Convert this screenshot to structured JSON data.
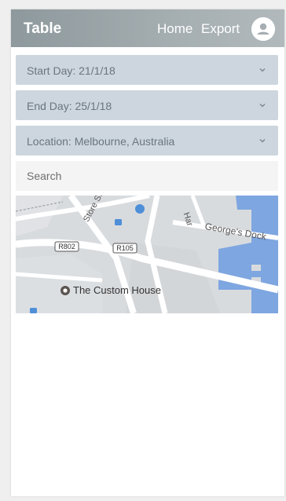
{
  "header": {
    "title": "Table",
    "nav": {
      "home": "Home",
      "export": "Export"
    },
    "avatar_icon": "user-avatar-icon"
  },
  "filters": {
    "start_day": "Start Day: 21/1/18",
    "end_day": "End Day: 25/1/18",
    "location": "Location: Melbourne, Australia"
  },
  "search": {
    "placeholder": "Search"
  },
  "map": {
    "labels": {
      "street_store": "Store St",
      "street_harbour": "Har",
      "georges_dock": "George's Dock",
      "road_r802": "R802",
      "road_r105": "R105",
      "landmark": "The Custom House"
    }
  },
  "colors": {
    "header_start": "#8e999d",
    "header_end": "#b1b9bc",
    "dropdown_bg": "#cdd6de",
    "water": "#7ea6e0"
  }
}
